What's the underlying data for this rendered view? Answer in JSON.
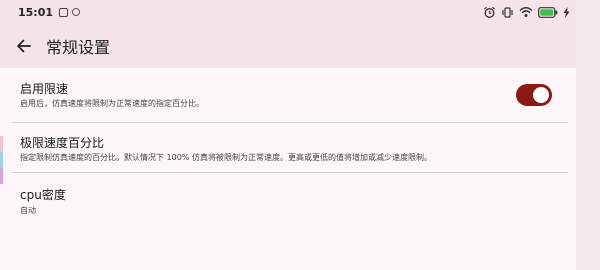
{
  "status_bar": {
    "time": "15:01",
    "icons": [
      "notification-box-icon",
      "notification-circle-icon",
      "alarm-icon",
      "vibrate-icon",
      "wifi-icon",
      "battery-icon",
      "charging-icon"
    ]
  },
  "toolbar": {
    "back_icon": "arrow-left-icon",
    "title": "常规设置"
  },
  "settings": {
    "limit_speed": {
      "title": "启用限速",
      "subtitle": "启用后，仿真速度将限制为正常速度的指定百分比。",
      "enabled": true
    },
    "speed_percent": {
      "title": "极限速度百分比",
      "subtitle": "指定限制仿真速度的百分比。默认情况下 100% 仿真将被限制为正常速度。更高或更低的值将增加或减少速度限制。"
    },
    "cpu_accuracy": {
      "title": "cpu密度",
      "value": "自动"
    }
  },
  "colors": {
    "accent": "#8b1b12",
    "background": "#fcf6f9",
    "toolbar": "#f4e4e9",
    "battery": "#3ec34a"
  }
}
